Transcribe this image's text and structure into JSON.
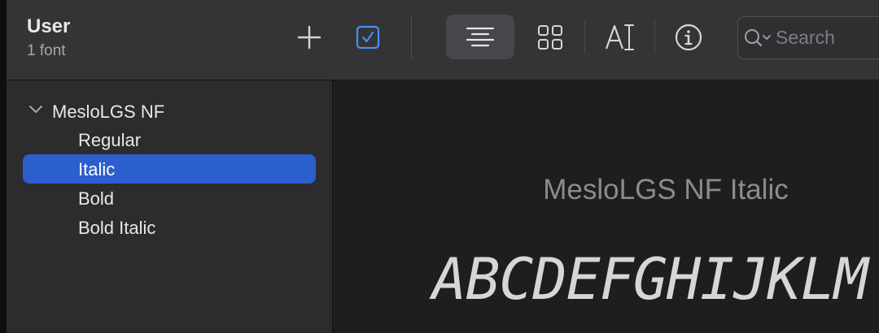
{
  "header": {
    "title": "User",
    "subtitle": "1 font"
  },
  "toolbar": {
    "icons": [
      "plus-icon",
      "checkbox-icon",
      "text-align-center-icon",
      "grid-icon",
      "text-cursor-icon",
      "info-icon",
      "search-icon"
    ],
    "accent_color": "#4a8ff0"
  },
  "search": {
    "placeholder": "Search",
    "value": ""
  },
  "sidebar": {
    "family": "MesloLGS NF",
    "faces": [
      {
        "label": "Regular",
        "selected": false
      },
      {
        "label": "Italic",
        "selected": true
      },
      {
        "label": "Bold",
        "selected": false
      },
      {
        "label": "Bold Italic",
        "selected": false
      }
    ],
    "selection_color": "#2b5fce"
  },
  "preview": {
    "font_name": "MesloLGS NF Italic",
    "sample": "ABCDEFGHIJKLM"
  }
}
